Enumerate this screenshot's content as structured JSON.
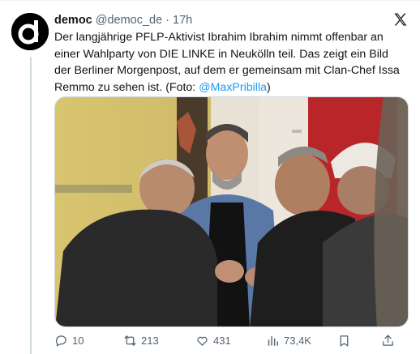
{
  "tweet": {
    "author_name": "democ",
    "handle": "@democ_de",
    "separator": "·",
    "time": "17h",
    "text_part1": "Der langjährige PFLP-Aktivist Ibrahim Ibrahim nimmt offenbar an einer Wahlparty von DIE LINKE in Neukölln teil. Das zeigt ein Bild der Berliner Morgenpost, auf dem er gemeinsam mit Clan-Chef Issa Remmo zu sehen ist. (Foto: ",
    "mention": "@MaxPribilla",
    "text_part2": ")"
  },
  "actions": {
    "replies": "10",
    "reposts": "213",
    "likes": "431",
    "views": "73,4K"
  },
  "icons": [
    "reply-icon",
    "repost-icon",
    "like-icon",
    "views-icon",
    "bookmark-icon",
    "share-icon",
    "x-logo-icon"
  ],
  "colors": {
    "accent": "#1d9bf0",
    "muted": "#536471",
    "text": "#0f1419"
  }
}
